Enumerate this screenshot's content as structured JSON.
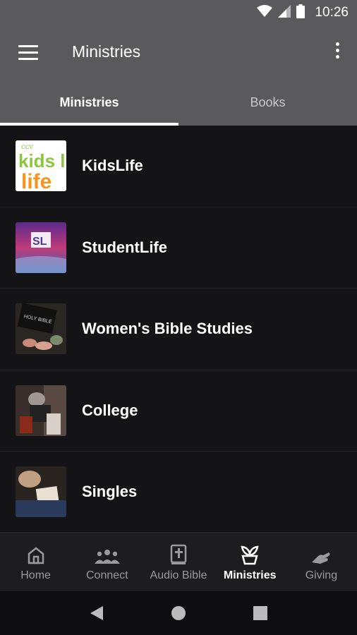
{
  "status": {
    "time": "10:26"
  },
  "appbar": {
    "title": "Ministries",
    "menu_icon": "hamburger-menu-icon",
    "overflow_icon": "more-vert-icon"
  },
  "tabs": [
    {
      "label": "Ministries",
      "active": true
    },
    {
      "label": "Books",
      "active": false
    }
  ],
  "list": {
    "items": [
      {
        "label": "KidsLife",
        "thumb_text": "kids life"
      },
      {
        "label": "StudentLife",
        "thumb_text": "SL"
      },
      {
        "label": "Women's Bible Studies",
        "thumb_text": "HOLY BIBLE"
      },
      {
        "label": "College"
      },
      {
        "label": "Singles"
      }
    ]
  },
  "bottomnav": {
    "items": [
      {
        "label": "Home",
        "icon": "home-icon"
      },
      {
        "label": "Connect",
        "icon": "group-icon"
      },
      {
        "label": "Audio Bible",
        "icon": "bible-icon"
      },
      {
        "label": "Ministries",
        "icon": "plant-pot-icon",
        "active": true
      },
      {
        "label": "Giving",
        "icon": "giving-hand-icon"
      }
    ]
  },
  "colors": {
    "appbar": "#5a5a5c",
    "background": "#141416",
    "kids_green": "#8cc63f",
    "kids_orange": "#f7941d"
  }
}
